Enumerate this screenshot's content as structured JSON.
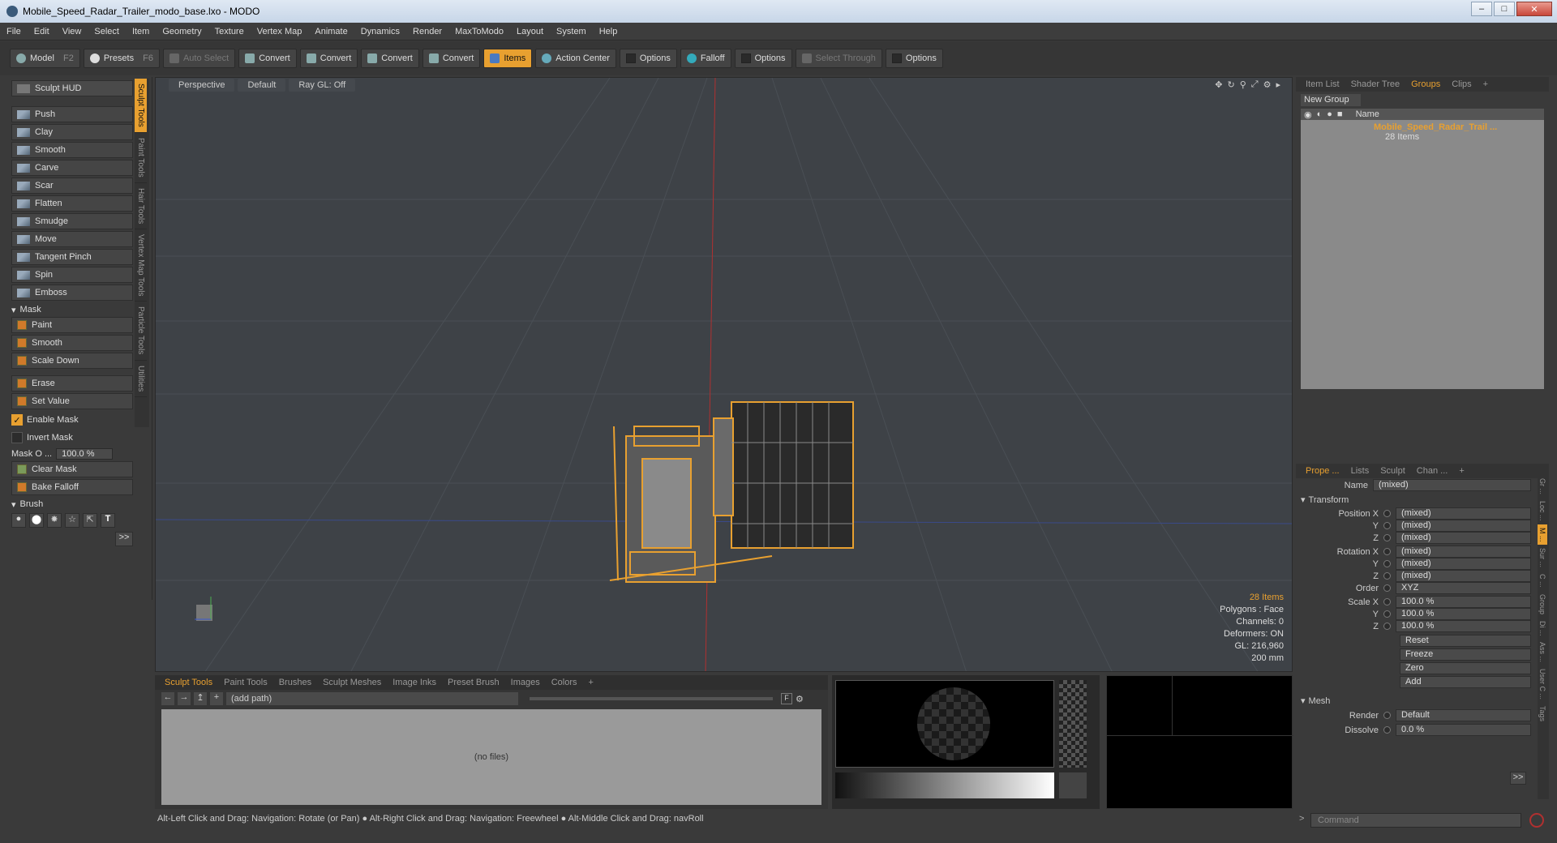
{
  "window": {
    "title": "Mobile_Speed_Radar_Trailer_modo_base.lxo - MODO"
  },
  "menu": [
    "File",
    "Edit",
    "View",
    "Select",
    "Item",
    "Geometry",
    "Texture",
    "Vertex Map",
    "Animate",
    "Dynamics",
    "Render",
    "MaxToModo",
    "Layout",
    "System",
    "Help"
  ],
  "toolbar": {
    "model": "Model",
    "model_key": "F2",
    "presets": "Presets",
    "presets_key": "F6",
    "auto_select": "Auto Select",
    "convert1": "Convert",
    "convert2": "Convert",
    "convert3": "Convert",
    "convert4": "Convert",
    "items": "Items",
    "action_center": "Action Center",
    "options1": "Options",
    "falloff": "Falloff",
    "options2": "Options",
    "select_through": "Select Through",
    "options3": "Options"
  },
  "sculpt": {
    "hud": "Sculpt HUD",
    "tools": [
      "Push",
      "Clay",
      "Smooth",
      "Carve",
      "Scar",
      "Flatten",
      "Smudge",
      "Move",
      "Tangent Pinch",
      "Spin",
      "Emboss"
    ],
    "mask_header": "Mask",
    "mask_tools": [
      "Paint",
      "Smooth",
      "Scale Down"
    ],
    "erase": "Erase",
    "set_value": "Set Value",
    "enable_mask": "Enable Mask",
    "invert_mask": "Invert Mask",
    "mask_opacity_label": "Mask O ...",
    "mask_opacity_value": "100.0 %",
    "clear_mask": "Clear Mask",
    "bake_falloff": "Bake Falloff",
    "brush_header": "Brush",
    "more": ">>"
  },
  "side_tabs": [
    "Sculpt Tools",
    "Paint Tools",
    "Hair Tools",
    "Vertex Map Tools",
    "Particle Tools",
    "Utilities"
  ],
  "viewport": {
    "view": "Perspective",
    "style": "Default",
    "raygl": "Ray GL: Off",
    "info": {
      "items": "28 Items",
      "polygons": "Polygons : Face",
      "channels": "Channels: 0",
      "deformers": "Deformers: ON",
      "gl": "GL: 216,960",
      "scale": "200 mm"
    }
  },
  "bottom_panel": {
    "tabs": [
      "Sculpt Tools",
      "Paint Tools",
      "Brushes",
      "Sculpt Meshes",
      "Image Inks",
      "Preset Brush",
      "Images",
      "Colors"
    ],
    "path": "(add path)",
    "no_files": "(no files)",
    "f_label": "F"
  },
  "right_panel": {
    "tabs": [
      "Item List",
      "Shader Tree",
      "Groups",
      "Clips"
    ],
    "new_group": "New Group",
    "name_col": "Name",
    "group_name": "Mobile_Speed_Radar_Trail ...",
    "group_count": "28 Items"
  },
  "properties": {
    "tabs": [
      "Prope ...",
      "Lists",
      "Sculpt",
      "Chan ..."
    ],
    "name_label": "Name",
    "name_value": "(mixed)",
    "transform": "Transform",
    "rows": [
      {
        "label": "Position X",
        "value": "(mixed)"
      },
      {
        "label": "Y",
        "value": "(mixed)"
      },
      {
        "label": "Z",
        "value": "(mixed)"
      },
      {
        "label": "Rotation X",
        "value": "(mixed)"
      },
      {
        "label": "Y",
        "value": "(mixed)"
      },
      {
        "label": "Z",
        "value": "(mixed)"
      },
      {
        "label": "Order",
        "value": "XYZ"
      },
      {
        "label": "Scale X",
        "value": "100.0 %"
      },
      {
        "label": "Y",
        "value": "100.0 %"
      },
      {
        "label": "Z",
        "value": "100.0 %"
      }
    ],
    "actions": [
      "Reset",
      "Freeze",
      "Zero",
      "Add"
    ],
    "mesh": "Mesh",
    "render_label": "Render",
    "render_value": "Default",
    "dissolve_label": "Dissolve",
    "dissolve_value": "0.0 %",
    "more": ">>",
    "side_tabs": [
      "Gr ...",
      "Loc ...",
      "M ...",
      "Sur ...",
      "C ...",
      "Group",
      "Di ...",
      "Ass ...",
      "User C ...",
      "Tags"
    ]
  },
  "status": "Alt-Left Click and Drag: Navigation: Rotate (or Pan) ● Alt-Right Click and Drag: Navigation: Freewheel ● Alt-Middle Click and Drag: navRoll",
  "command_placeholder": "Command",
  "colors": {
    "accent": "#e8a030",
    "viewport_bg": "#3e4247"
  }
}
